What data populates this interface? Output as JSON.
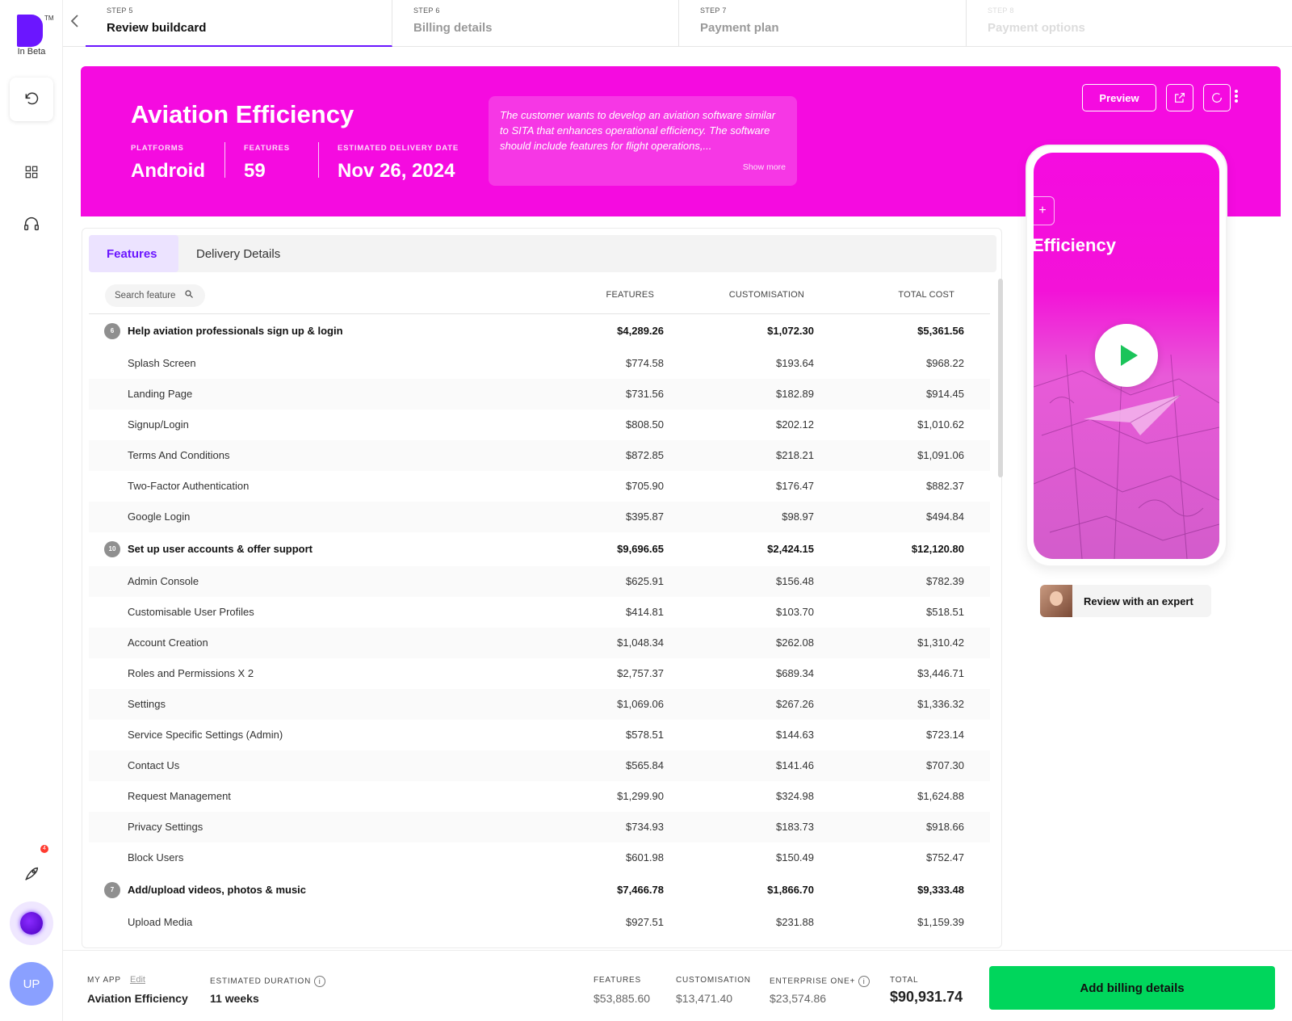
{
  "brand": {
    "tm": "TM",
    "beta_label": "In Beta"
  },
  "sidebar": {
    "notification_count": "4",
    "user_initials": "UP"
  },
  "steps": [
    {
      "num": "STEP 5",
      "title": "Review buildcard"
    },
    {
      "num": "STEP 6",
      "title": "Billing details"
    },
    {
      "num": "STEP 7",
      "title": "Payment plan"
    },
    {
      "num": "STEP 8",
      "title": "Payment options"
    }
  ],
  "hero": {
    "title": "Aviation Efficiency",
    "platforms_label": "PLATFORMS",
    "platforms_value": "Android",
    "features_label": "FEATURES",
    "features_value": "59",
    "delivery_label": "ESTIMATED DELIVERY DATE",
    "delivery_value": "Nov 26, 2024",
    "description": "The customer wants to develop an aviation software similar to SITA that enhances operational efficiency. The software should include features for flight operations,...",
    "show_more": "Show more",
    "preview_label": "Preview",
    "bg_color": "#f50be0"
  },
  "phone": {
    "title": "Efficiency",
    "plus": "+"
  },
  "expert": {
    "label": "Review with an expert"
  },
  "table": {
    "tabs": [
      "Features",
      "Delivery Details"
    ],
    "search_placeholder": "Search feature",
    "columns": [
      "FEATURES",
      "CUSTOMISATION",
      "TOTAL COST"
    ],
    "rows": [
      {
        "type": "group",
        "count": "6",
        "name": "Help aviation professionals sign up & login",
        "features": "$4,289.26",
        "custom": "$1,072.30",
        "total": "$5,361.56"
      },
      {
        "type": "item",
        "name": "Splash Screen",
        "features": "$774.58",
        "custom": "$193.64",
        "total": "$968.22"
      },
      {
        "type": "item",
        "name": "Landing Page",
        "features": "$731.56",
        "custom": "$182.89",
        "total": "$914.45"
      },
      {
        "type": "item",
        "name": "Signup/Login",
        "features": "$808.50",
        "custom": "$202.12",
        "total": "$1,010.62"
      },
      {
        "type": "item",
        "name": "Terms And Conditions",
        "features": "$872.85",
        "custom": "$218.21",
        "total": "$1,091.06"
      },
      {
        "type": "item",
        "name": "Two-Factor Authentication",
        "features": "$705.90",
        "custom": "$176.47",
        "total": "$882.37"
      },
      {
        "type": "item",
        "name": "Google Login",
        "features": "$395.87",
        "custom": "$98.97",
        "total": "$494.84"
      },
      {
        "type": "group",
        "count": "10",
        "name": "Set up user accounts & offer support",
        "features": "$9,696.65",
        "custom": "$2,424.15",
        "total": "$12,120.80"
      },
      {
        "type": "item",
        "name": "Admin Console",
        "features": "$625.91",
        "custom": "$156.48",
        "total": "$782.39"
      },
      {
        "type": "item",
        "name": "Customisable User Profiles",
        "features": "$414.81",
        "custom": "$103.70",
        "total": "$518.51"
      },
      {
        "type": "item",
        "name": "Account Creation",
        "features": "$1,048.34",
        "custom": "$262.08",
        "total": "$1,310.42"
      },
      {
        "type": "item",
        "name": "Roles and Permissions X 2",
        "features": "$2,757.37",
        "custom": "$689.34",
        "total": "$3,446.71"
      },
      {
        "type": "item",
        "name": "Settings",
        "features": "$1,069.06",
        "custom": "$267.26",
        "total": "$1,336.32"
      },
      {
        "type": "item",
        "name": "Service Specific Settings (Admin)",
        "features": "$578.51",
        "custom": "$144.63",
        "total": "$723.14"
      },
      {
        "type": "item",
        "name": "Contact Us",
        "features": "$565.84",
        "custom": "$141.46",
        "total": "$707.30"
      },
      {
        "type": "item",
        "name": "Request Management",
        "features": "$1,299.90",
        "custom": "$324.98",
        "total": "$1,624.88"
      },
      {
        "type": "item",
        "name": "Privacy Settings",
        "features": "$734.93",
        "custom": "$183.73",
        "total": "$918.66"
      },
      {
        "type": "item",
        "name": "Block Users",
        "features": "$601.98",
        "custom": "$150.49",
        "total": "$752.47"
      },
      {
        "type": "group",
        "count": "7",
        "name": "Add/upload videos, photos & music",
        "features": "$7,466.78",
        "custom": "$1,866.70",
        "total": "$9,333.48"
      },
      {
        "type": "item",
        "name": "Upload Media",
        "features": "$927.51",
        "custom": "$231.88",
        "total": "$1,159.39"
      }
    ]
  },
  "footer": {
    "my_app_label": "MY APP",
    "edit_label": "Edit",
    "app_name": "Aviation Efficiency",
    "duration_label": "ESTIMATED DURATION",
    "duration_value": "11 weeks",
    "features_label": "FEATURES",
    "features_value": "$53,885.60",
    "custom_label": "CUSTOMISATION",
    "custom_value": "$13,471.40",
    "enterprise_label": "ENTERPRISE ONE+",
    "enterprise_value": "$23,574.86",
    "total_label": "TOTAL",
    "total_value": "$90,931.74",
    "cta_label": "Add billing details",
    "cta_color": "#00d65c"
  }
}
